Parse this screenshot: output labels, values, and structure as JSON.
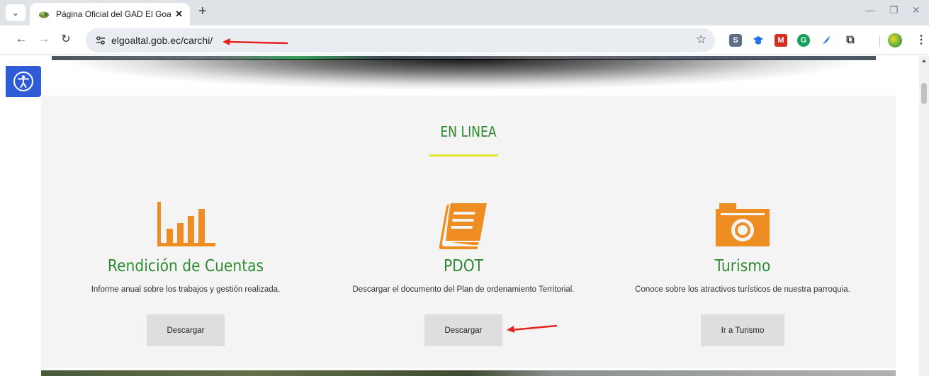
{
  "browser": {
    "tab_title": "Página Oficial del GAD El Goalta",
    "tab_close": "✕",
    "new_tab": "+",
    "url": "elgoaltal.gob.ec/carchi/",
    "icons": [
      "back-icon",
      "forward-icon",
      "reload-icon",
      "site-info-icon",
      "star-icon",
      "extensions-icon",
      "profile-icon",
      "menu-icon"
    ],
    "window_controls": {
      "minimize": "—",
      "restore": "❐",
      "close": "✕"
    }
  },
  "page": {
    "section_title": "EN LINEA",
    "accent_color": "#2e8b33",
    "icon_color": "#ee8e22",
    "underline_color": "#e3e52c",
    "cards": [
      {
        "icon": "bar-chart-icon",
        "title": "Rendición de Cuentas",
        "description": "Informe anual sobre los trabajos y gestión realizada.",
        "button": "Descargar"
      },
      {
        "icon": "book-icon",
        "title": "PDOT",
        "description": "Descargar el documento del Plan de ordenamiento Territorial.",
        "button": "Descargar"
      },
      {
        "icon": "camera-icon",
        "title": "Turismo",
        "description": "Conoce sobre los atractivos turísticos de nuestra parroquia.",
        "button": "Ir a Turismo"
      }
    ],
    "accessibility_button": "accessibility-icon"
  },
  "annotations": {
    "arrow_color": "#e8211c"
  }
}
